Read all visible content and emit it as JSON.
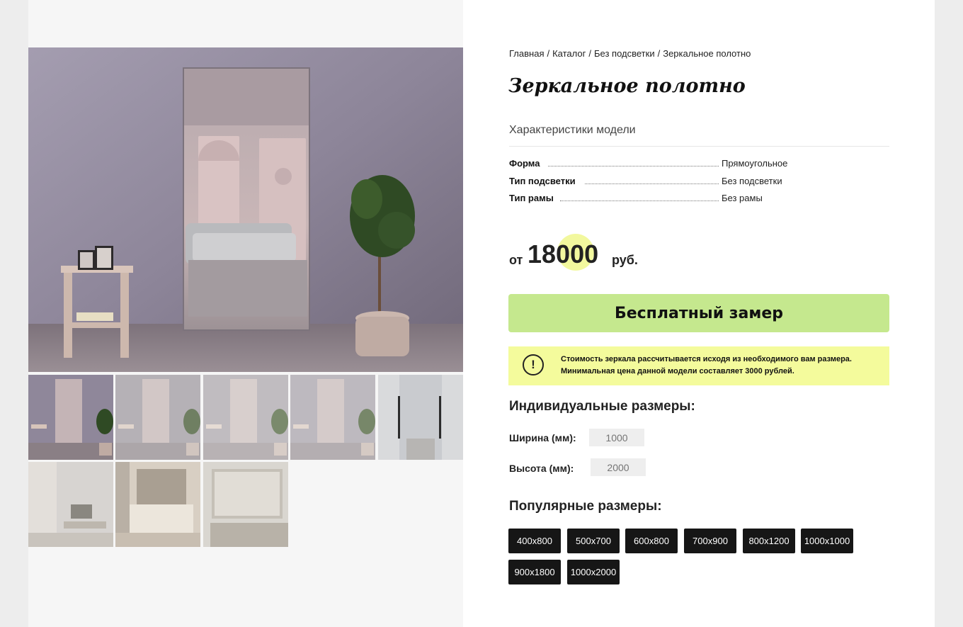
{
  "breadcrumb": {
    "items": [
      "Главная",
      "Каталог",
      "Без подсветки",
      "Зеркальное полотно"
    ],
    "separator": "/"
  },
  "product": {
    "title": "Зеркальное полотно"
  },
  "specs": {
    "heading": "Характеристики модели",
    "rows": [
      {
        "key": "Форма",
        "value": "Прямоугольное"
      },
      {
        "key": "Тип подсветки",
        "value": "Без подсветки"
      },
      {
        "key": "Тип рамы",
        "value": "Без рамы"
      }
    ]
  },
  "price": {
    "prefix": "от",
    "value": "18000",
    "currency": "руб."
  },
  "cta": {
    "measure_label": "Бесплатный замер",
    "color": "#c5e88e"
  },
  "notice": {
    "icon": "exclamation-circle-icon",
    "line1": "Стоимость зеркала рассчитывается исходя из необходимого вам размера.",
    "line2": "Минимальная цена данной модели составляет 3000 рублей.",
    "color": "#f4fb9c"
  },
  "custom_sizes": {
    "heading": "Индивидуальные размеры:",
    "width_label": "Ширина (мм):",
    "width_placeholder": "1000",
    "height_label": "Высота (мм):",
    "height_placeholder": "2000"
  },
  "popular_sizes": {
    "heading": "Популярные размеры:",
    "sizes": [
      "400x800",
      "500x700",
      "600x800",
      "700x900",
      "800x1200",
      "1000x1000",
      "900x1800",
      "1000x2000"
    ]
  },
  "gallery": {
    "main_image": "mirror-room-photo",
    "thumbnails": [
      "mirror-room-thumb-1",
      "mirror-room-thumb-2",
      "mirror-room-thumb-3",
      "mirror-room-thumb-4",
      "hallway-lamps-thumb",
      "living-room-thumb",
      "bedroom-thumb",
      "bathroom-mirror-thumb"
    ]
  }
}
